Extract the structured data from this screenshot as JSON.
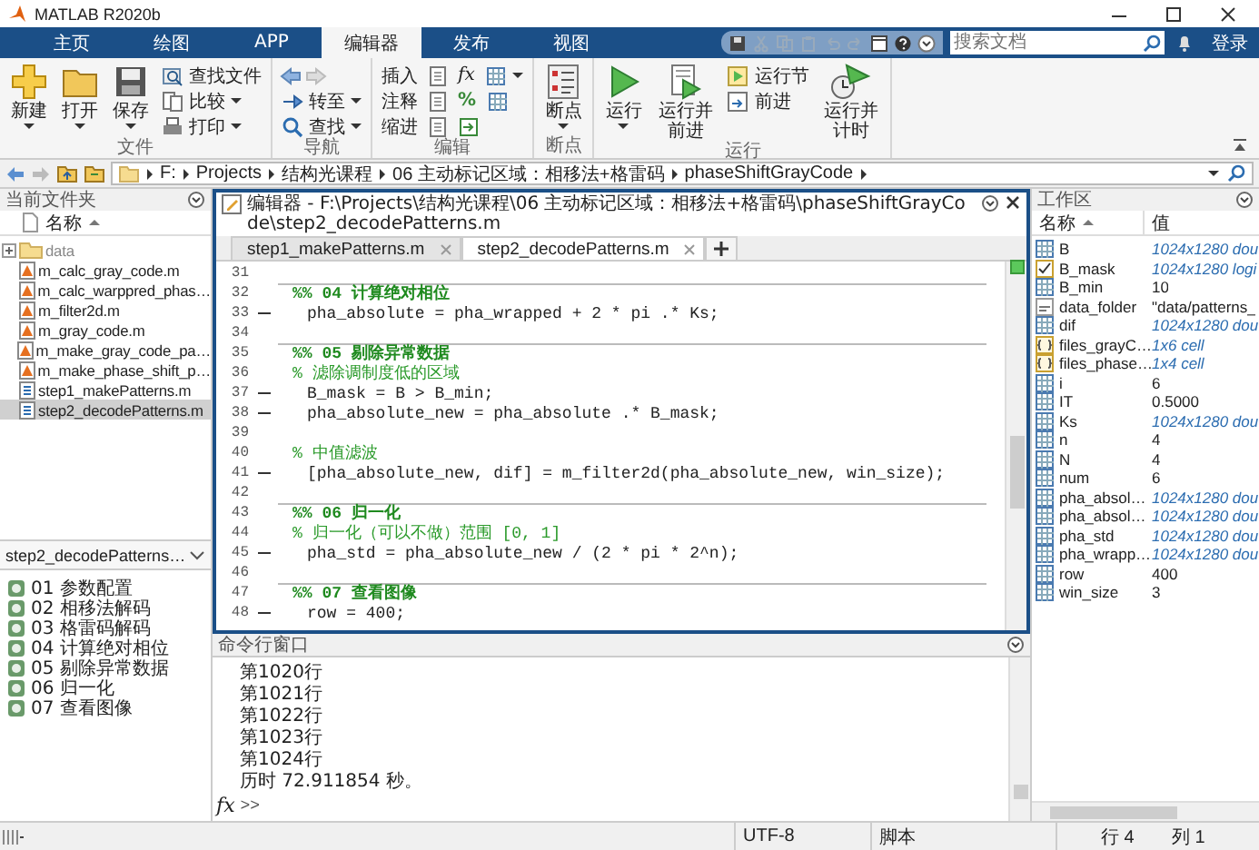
{
  "window": {
    "title": "MATLAB R2020b"
  },
  "ribbon_tabs": [
    {
      "label": "主页",
      "selected": false
    },
    {
      "label": "绘图",
      "selected": false
    },
    {
      "label": "APP",
      "selected": false
    },
    {
      "label": "编辑器",
      "selected": true
    },
    {
      "label": "发布",
      "selected": false
    },
    {
      "label": "视图",
      "selected": false
    }
  ],
  "search": {
    "placeholder": "搜索文档"
  },
  "sign_in": "登录",
  "toolstrip": [
    {
      "title": "文件",
      "large": [
        {
          "label": "新建",
          "menu": true
        },
        {
          "label": "打开",
          "menu": true
        },
        {
          "label": "保存",
          "menu": true
        }
      ],
      "small": [
        {
          "label": "查找文件",
          "menu": false
        },
        {
          "label": "比较",
          "menu": true
        },
        {
          "label": "打印",
          "menu": true
        }
      ]
    },
    {
      "title": "导航",
      "small": [
        {
          "label": "转至",
          "menu": true
        },
        {
          "label": "查找",
          "menu": true
        }
      ]
    },
    {
      "title": "编辑",
      "small": [
        {
          "label": "插入",
          "symbol": "fx",
          "menu": true
        },
        {
          "label": "注释",
          "symbol": "%",
          "menu": false
        },
        {
          "label": "缩进",
          "menu": false
        }
      ]
    },
    {
      "title": "断点",
      "large": [
        {
          "label": "断点",
          "menu": true
        }
      ]
    },
    {
      "title": "运行",
      "large": [
        {
          "label": "运行",
          "menu": true
        },
        {
          "label": "运行并前进",
          "menu": false
        }
      ],
      "small": [
        {
          "label": "运行节",
          "menu": false
        },
        {
          "label": "前进",
          "menu": false
        }
      ],
      "large_after": [
        {
          "label": "运行并计时",
          "menu": false
        }
      ]
    }
  ],
  "address": {
    "path": [
      "F:",
      "Projects",
      "结构光课程",
      "06 主动标记区域：相移法+格雷码",
      "phaseShiftGrayCode"
    ]
  },
  "current_folder": {
    "title": "当前文件夹",
    "column": "名称",
    "files": [
      {
        "name": "data",
        "kind": "folder",
        "selected": false
      },
      {
        "name": "m_calc_gray_code.m",
        "kind": "function",
        "selected": false
      },
      {
        "name": "m_calc_warppred_phas…",
        "kind": "function",
        "selected": false
      },
      {
        "name": "m_filter2d.m",
        "kind": "function",
        "selected": false
      },
      {
        "name": "m_gray_code.m",
        "kind": "function",
        "selected": false
      },
      {
        "name": "m_make_gray_code_pa…",
        "kind": "function",
        "selected": false
      },
      {
        "name": "m_make_phase_shift_p…",
        "kind": "function",
        "selected": false
      },
      {
        "name": "step1_makePatterns.m",
        "kind": "script",
        "selected": false
      },
      {
        "name": "step2_decodePatterns.m",
        "kind": "script",
        "selected": true
      }
    ]
  },
  "details": {
    "file": "step2_decodePatterns…",
    "sections": [
      "01 参数配置",
      "02 相移法解码",
      "03 格雷码解码",
      "04 计算绝对相位",
      "05 剔除异常数据",
      "06 归一化",
      "07 查看图像"
    ]
  },
  "editor": {
    "title": "编辑器 - F:\\Projects\\结构光课程\\06 主动标记区域：相移法+格雷码\\phaseShiftGrayCode\\step2_decodePatterns.m",
    "tabs": [
      {
        "label": "step1_makePatterns.m",
        "selected": false
      },
      {
        "label": "step2_decodePatterns.m",
        "selected": true
      }
    ],
    "lines": [
      {
        "number": "31",
        "kind": "blank",
        "executable": false
      },
      {
        "number": "32",
        "kind": "section",
        "text": "%% 04 计算绝对相位",
        "executable": false
      },
      {
        "number": "33",
        "kind": "code",
        "text": "pha_absolute = pha_wrapped + 2 * pi .* Ks;",
        "executable": true
      },
      {
        "number": "34",
        "kind": "blank",
        "executable": false
      },
      {
        "number": "35",
        "kind": "section",
        "text": "%% 05 剔除异常数据",
        "executable": false
      },
      {
        "number": "36",
        "kind": "comment",
        "text": "% 滤除调制度低的区域",
        "executable": false
      },
      {
        "number": "37",
        "kind": "code",
        "text": "B_mask = B > B_min;",
        "executable": true
      },
      {
        "number": "38",
        "kind": "code",
        "text": "pha_absolute_new = pha_absolute .* B_mask;",
        "executable": true
      },
      {
        "number": "39",
        "kind": "blank",
        "executable": false
      },
      {
        "number": "40",
        "kind": "comment",
        "text": "% 中值滤波",
        "executable": false
      },
      {
        "number": "41",
        "kind": "code",
        "text": "[pha_absolute_new, dif] = m_filter2d(pha_absolute_new, win_size);",
        "executable": true
      },
      {
        "number": "42",
        "kind": "blank",
        "executable": false
      },
      {
        "number": "43",
        "kind": "section",
        "text": "%% 06 归一化",
        "executable": false
      },
      {
        "number": "44",
        "kind": "comment",
        "text": "% 归一化（可以不做）范围 [0, 1]",
        "executable": false
      },
      {
        "number": "45",
        "kind": "code",
        "text": "pha_std = pha_absolute_new / (2 * pi * 2^n);",
        "executable": true
      },
      {
        "number": "46",
        "kind": "blank",
        "executable": false
      },
      {
        "number": "47",
        "kind": "section",
        "text": "%% 07 查看图像",
        "executable": false
      },
      {
        "number": "48",
        "kind": "code",
        "text": "row = 400;",
        "executable": true
      }
    ]
  },
  "command_window": {
    "title": "命令行窗口",
    "lines": [
      "第1020行",
      "第1021行",
      "第1022行",
      "第1023行",
      "第1024行",
      "历时 72.911854 秒。"
    ],
    "prompt_symbol": "fx",
    "prompt": ">>"
  },
  "workspace": {
    "title": "工作区",
    "columns": [
      "名称",
      "值"
    ],
    "variables": [
      {
        "name": "B",
        "value": "1024x1280 dou",
        "kind": "matrix",
        "summary": true
      },
      {
        "name": "B_mask",
        "value": "1024x1280 logi",
        "kind": "logical",
        "summary": true
      },
      {
        "name": "B_min",
        "value": "10",
        "kind": "matrix",
        "summary": false
      },
      {
        "name": "data_folder",
        "value": "\"data/patterns_",
        "kind": "char",
        "summary": false
      },
      {
        "name": "dif",
        "value": "1024x1280 dou",
        "kind": "matrix",
        "summary": true
      },
      {
        "name": "files_grayC…",
        "value": "1x6 cell",
        "kind": "cell",
        "summary": true
      },
      {
        "name": "files_phase…",
        "value": "1x4 cell",
        "kind": "cell",
        "summary": true
      },
      {
        "name": "i",
        "value": "6",
        "kind": "matrix",
        "summary": false
      },
      {
        "name": "IT",
        "value": "0.5000",
        "kind": "matrix",
        "summary": false
      },
      {
        "name": "Ks",
        "value": "1024x1280 dou",
        "kind": "matrix",
        "summary": true
      },
      {
        "name": "n",
        "value": "4",
        "kind": "matrix",
        "summary": false
      },
      {
        "name": "N",
        "value": "4",
        "kind": "matrix",
        "summary": false
      },
      {
        "name": "num",
        "value": "6",
        "kind": "matrix",
        "summary": false
      },
      {
        "name": "pha_absol…",
        "value": "1024x1280 dou",
        "kind": "matrix",
        "summary": true
      },
      {
        "name": "pha_absol…",
        "value": "1024x1280 dou",
        "kind": "matrix",
        "summary": true
      },
      {
        "name": "pha_std",
        "value": "1024x1280 dou",
        "kind": "matrix",
        "summary": true
      },
      {
        "name": "pha_wrapp…",
        "value": "1024x1280 dou",
        "kind": "matrix",
        "summary": true
      },
      {
        "name": "row",
        "value": "400",
        "kind": "matrix",
        "summary": false
      },
      {
        "name": "win_size",
        "value": "3",
        "kind": "matrix",
        "summary": false
      }
    ]
  },
  "status_bar": {
    "encoding": "UTF-8",
    "file_type": "脚本",
    "line": "行  4",
    "column": "列  1"
  }
}
